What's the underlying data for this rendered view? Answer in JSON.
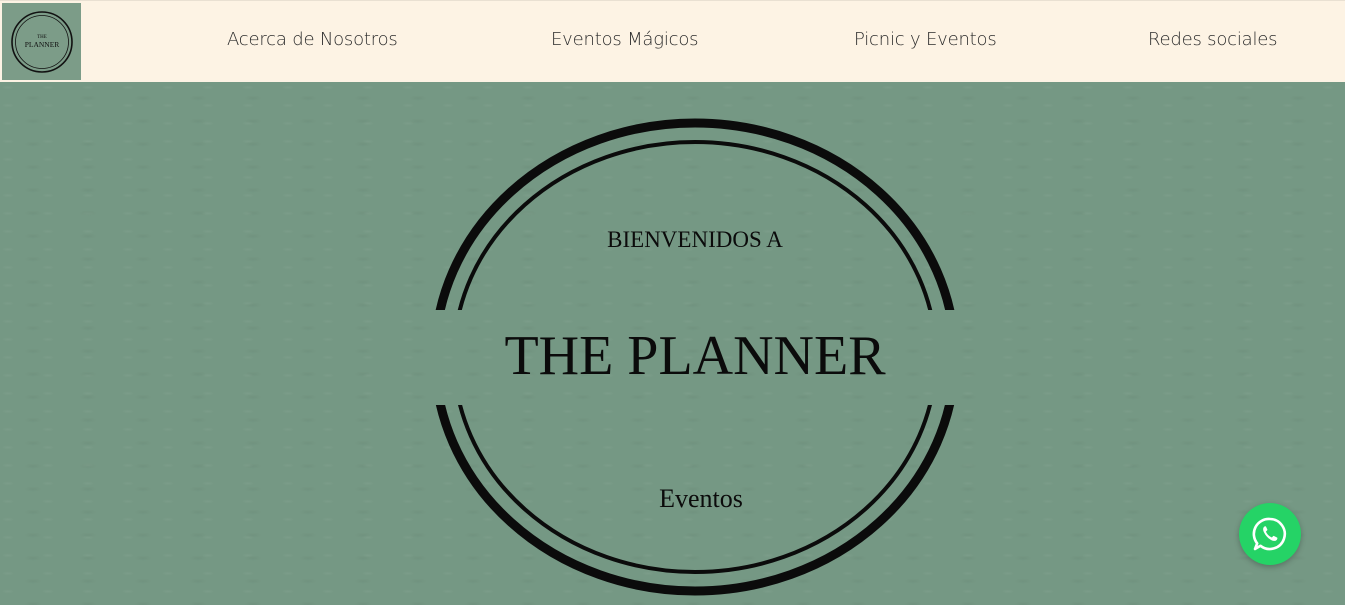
{
  "nav": {
    "logo_text": "THE PLANNER",
    "links": [
      "Acerca de Nosotros",
      "Eventos Mágicos",
      "Picnic y Eventos",
      "Redes sociales"
    ]
  },
  "hero": {
    "kicker": "BIENVENIDOS A",
    "title": "THE PLANNER",
    "subtitle": "Eventos"
  },
  "whatsapp": {
    "icon": "whatsapp-icon"
  },
  "colors": {
    "nav_bg": "#fdf3e4",
    "hero_bg": "#759884",
    "whatsapp": "#25d366"
  }
}
